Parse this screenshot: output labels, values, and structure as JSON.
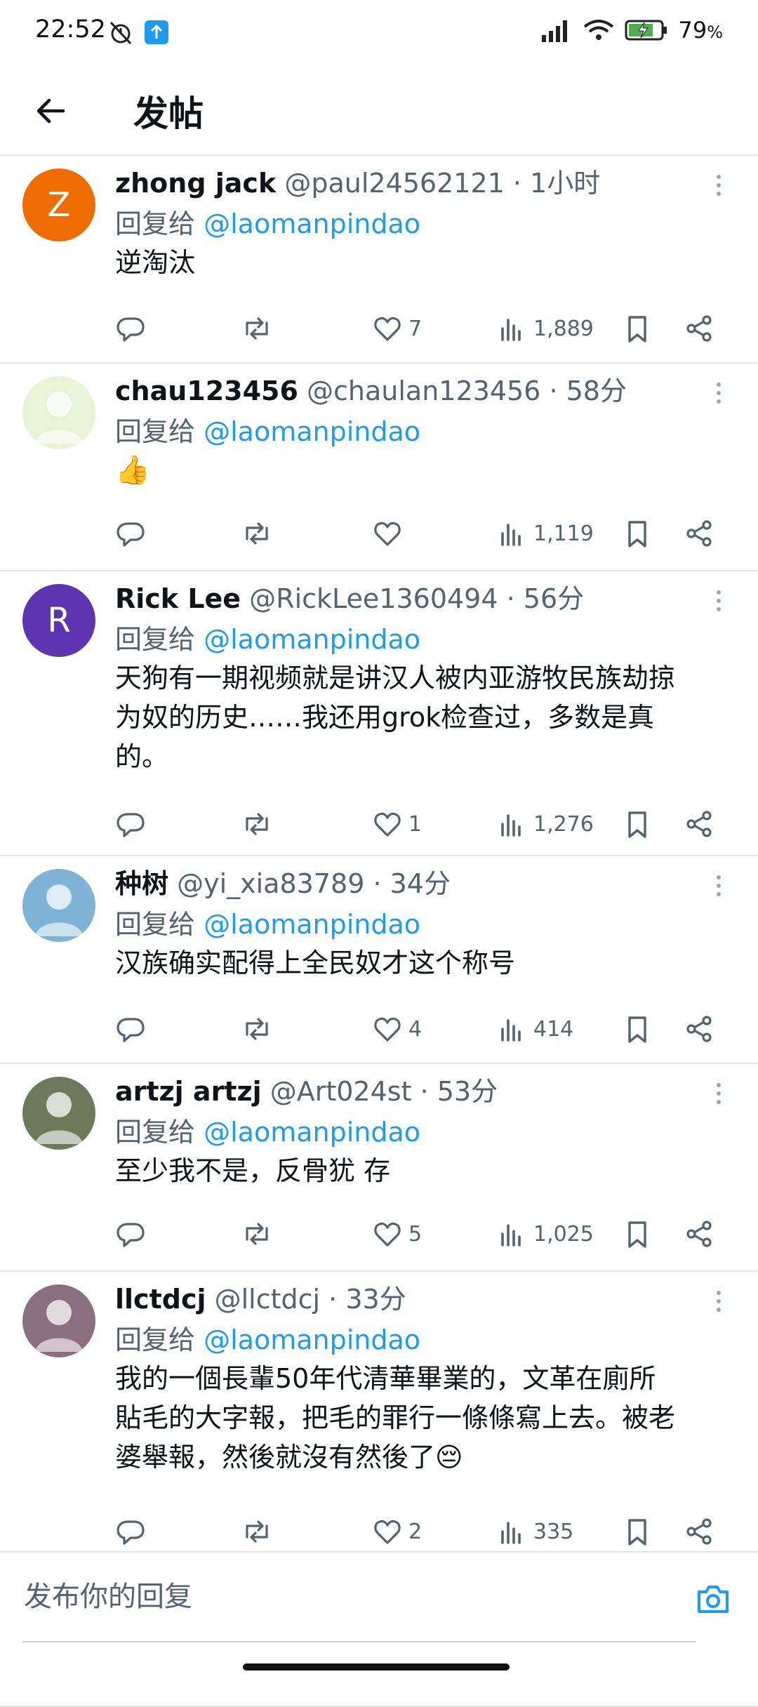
{
  "status_bar": {
    "time": "22:52",
    "battery": "79",
    "battery_unit": "%"
  },
  "header": {
    "title": "发帖"
  },
  "reply_prefix": "回复给",
  "tweets": [
    {
      "name": "zhong jack",
      "handle": "@paul24562121",
      "time": "· 1小时",
      "reply_to": "@laomanpindao",
      "lines": [
        "逆淘汰"
      ],
      "likes": "7",
      "views": "1,889",
      "avatar_letter": "Z",
      "avatar_color": "#ef6c00"
    },
    {
      "name": "chau123456",
      "handle": "@chaulan123456",
      "time": "· 58分",
      "reply_to": "@laomanpindao",
      "lines": [
        "👍"
      ],
      "likes": "",
      "views": "1,119",
      "avatar_letter": "",
      "avatar_color": "#e8f3d8"
    },
    {
      "name": "Rick Lee",
      "handle": "@RickLee1360494",
      "time": "· 56分",
      "reply_to": "@laomanpindao",
      "lines": [
        "天狗有一期视频就是讲汉人被内亚游牧民族劫掠",
        "为奴的历史……我还用grok检查过，多数是真",
        "的。"
      ],
      "likes": "1",
      "views": "1,276",
      "avatar_letter": "R",
      "avatar_color": "#5e35b1"
    },
    {
      "name": "种树",
      "handle": "@yi_xia83789",
      "time": "· 34分",
      "reply_to": "@laomanpindao",
      "lines": [
        "汉族确实配得上全民奴才这个称号"
      ],
      "likes": "4",
      "views": "414",
      "avatar_letter": "",
      "avatar_color": "#7fb3d5"
    },
    {
      "name": "artzj artzj",
      "handle": "@Art024st",
      "time": "· 53分",
      "reply_to": "@laomanpindao",
      "lines": [
        "至少我不是，反骨犹 存"
      ],
      "likes": "5",
      "views": "1,025",
      "avatar_letter": "",
      "avatar_color": "#6b7a5a"
    },
    {
      "name": "llctdcj",
      "handle": "@llctdcj",
      "time": "· 33分",
      "reply_to": "@laomanpindao",
      "lines": [
        "我的一個長輩50年代清華畢業的，文革在廁所",
        "貼毛的大字報，把毛的罪行一條條寫上去。被老",
        "婆舉報，然後就沒有然後了😔"
      ],
      "likes": "2",
      "views": "335",
      "avatar_letter": "",
      "avatar_color": "#8a6f7e"
    }
  ],
  "compose": {
    "placeholder": "发布你的回复"
  },
  "icons": {
    "back": "arrow-left-icon",
    "more": "more-vertical-icon",
    "reply": "reply-icon",
    "retweet": "retweet-icon",
    "like": "heart-icon",
    "views": "views-icon",
    "bookmark": "bookmark-icon",
    "share": "share-icon",
    "camera": "camera-icon"
  },
  "colors": {
    "accent": "#1d9bf0",
    "secondary_text": "#536471"
  }
}
